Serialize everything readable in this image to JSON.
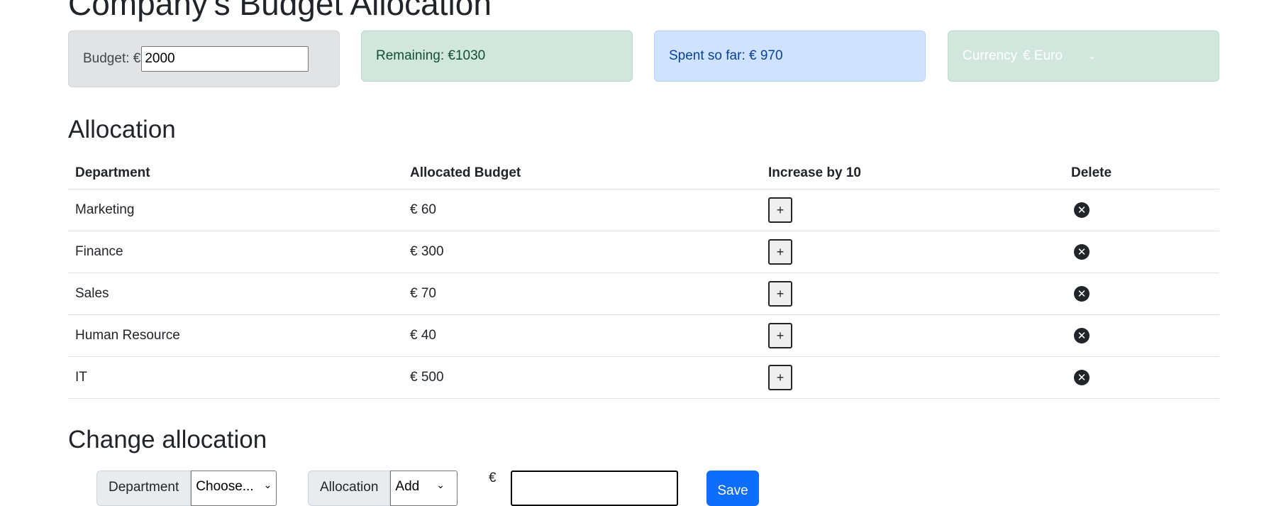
{
  "header": {
    "title": "Company's Budget Allocation"
  },
  "cards": {
    "budget": {
      "label": "Budget: €",
      "value": "2000"
    },
    "remaining": {
      "label": "Remaining: €1030"
    },
    "spent": {
      "label": "Spent so far: € 970"
    },
    "currency": {
      "label": "Currency",
      "selected": "€ Euro"
    }
  },
  "allocation": {
    "title": "Allocation",
    "columns": [
      "Department",
      "Allocated Budget",
      "Increase by 10",
      "Delete"
    ],
    "rows": [
      {
        "department": "Marketing",
        "budget": "€ 60"
      },
      {
        "department": "Finance",
        "budget": "€ 300"
      },
      {
        "department": "Sales",
        "budget": "€ 70"
      },
      {
        "department": "Human Resource",
        "budget": "€ 40"
      },
      {
        "department": "IT",
        "budget": "€ 500"
      }
    ],
    "increase_label": "+"
  },
  "change": {
    "title": "Change allocation",
    "department_label": "Department",
    "department_selected": "Choose...",
    "allocation_label": "Allocation",
    "allocation_selected": "Add",
    "currency_symbol": "€",
    "amount_value": "",
    "save_label": "Save"
  }
}
